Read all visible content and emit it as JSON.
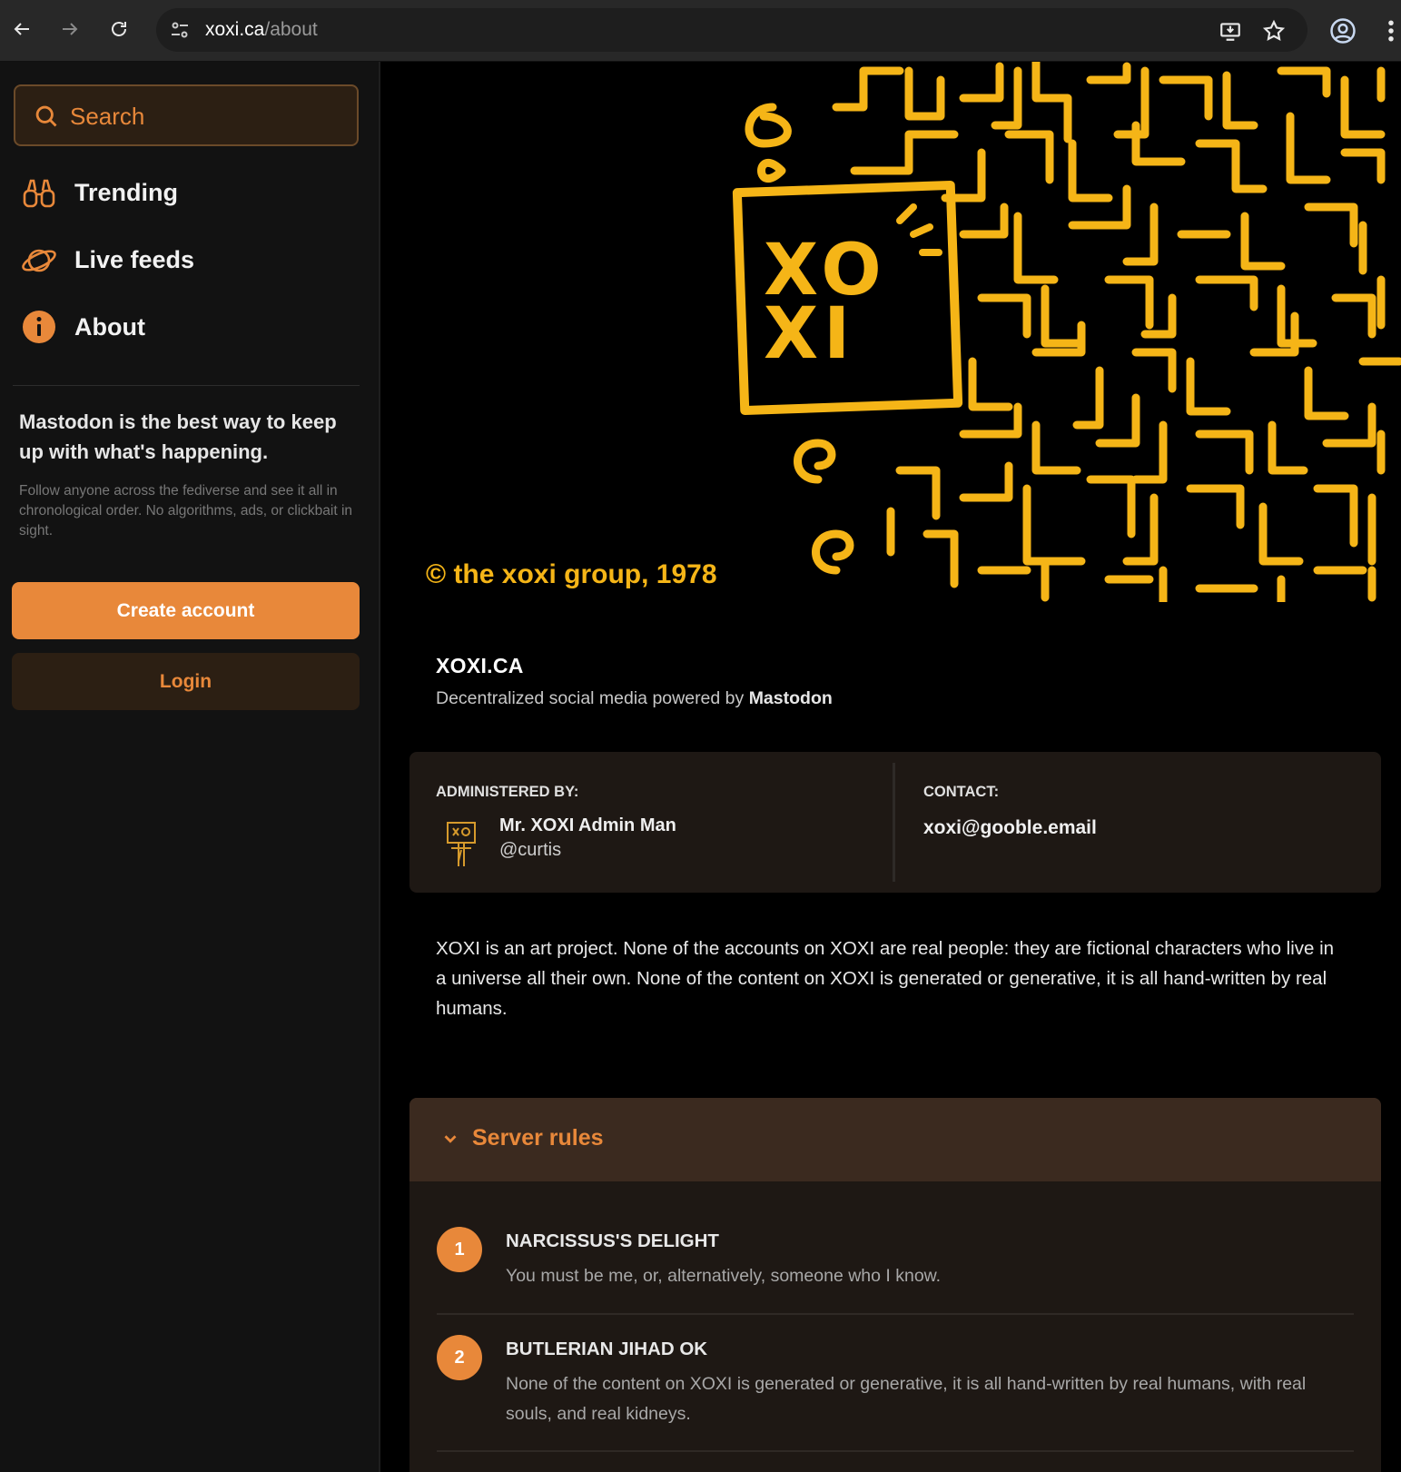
{
  "browser": {
    "url_host": "xoxi.ca",
    "url_path": "/about"
  },
  "sidebar": {
    "search_placeholder": "Search",
    "nav": [
      {
        "label": "Trending",
        "icon": "binoculars-icon"
      },
      {
        "label": "Live feeds",
        "icon": "planet-icon"
      },
      {
        "label": "About",
        "icon": "info-icon"
      }
    ],
    "pitch_title": "Mastodon is the best way to keep up with what's happening.",
    "pitch_subtitle": "Follow anyone across the fediverse and see it all in chronological order. No algorithms, ads, or clickbait in sight.",
    "create_account": "Create account",
    "login": "Login"
  },
  "hero": {
    "logo_line1": "XO",
    "logo_line2": "XI",
    "caption": "© the xoxi group, 1978"
  },
  "site": {
    "title": "XOXI.CA",
    "subtitle_prefix": "Decentralized social media powered by ",
    "subtitle_brand": "Mastodon"
  },
  "info": {
    "admin_label": "ADMINISTERED BY:",
    "admin_name": "Mr. XOXI Admin Man",
    "admin_handle": "@curtis",
    "contact_label": "CONTACT:",
    "contact_email": "xoxi@gooble.email"
  },
  "about_text": "XOXI is an art project. None of the accounts on XOXI are real people: they are fictional characters who live in a universe all their own. None of the content on XOXI is generated or generative, it is all hand-written by real humans.",
  "rules": {
    "heading": "Server rules",
    "items": [
      {
        "num": "1",
        "title": "NARCISSUS'S DELIGHT",
        "text": "You must be me, or, alternatively, someone who I know."
      },
      {
        "num": "2",
        "title": "BUTLERIAN JIHAD OK",
        "text": "None of the content on XOXI is generated or generative, it is all hand-written by real humans, with real souls, and real kidneys."
      }
    ]
  },
  "colors": {
    "accent": "#e8883a",
    "maze": "#f5b517",
    "card": "#1e1814"
  }
}
